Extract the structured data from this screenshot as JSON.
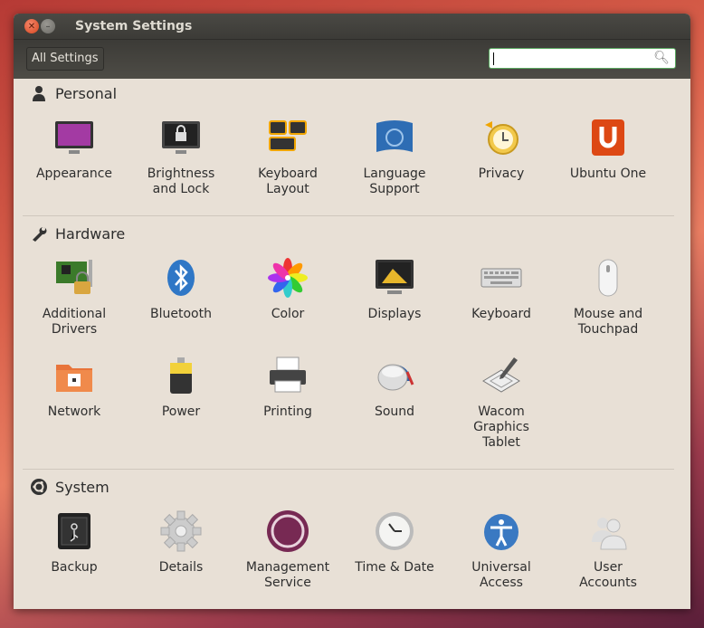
{
  "window": {
    "title": "System Settings"
  },
  "toolbar": {
    "all_settings_label": "All Settings",
    "search": {
      "value": "",
      "placeholder": ""
    }
  },
  "sections": [
    {
      "title": "Personal",
      "icon": "person-icon",
      "items": [
        {
          "label": "Appearance",
          "icon": "appearance-icon"
        },
        {
          "label": "Brightness\nand Lock",
          "icon": "brightness-lock-icon"
        },
        {
          "label": "Keyboard\nLayout",
          "icon": "keyboard-layout-icon"
        },
        {
          "label": "Language\nSupport",
          "icon": "language-support-icon"
        },
        {
          "label": "Privacy",
          "icon": "privacy-icon"
        },
        {
          "label": "Ubuntu One",
          "icon": "ubuntu-one-icon"
        }
      ]
    },
    {
      "title": "Hardware",
      "icon": "wrench-icon",
      "items": [
        {
          "label": "Additional\nDrivers",
          "icon": "additional-drivers-icon"
        },
        {
          "label": "Bluetooth",
          "icon": "bluetooth-icon"
        },
        {
          "label": "Color",
          "icon": "color-icon"
        },
        {
          "label": "Displays",
          "icon": "displays-icon"
        },
        {
          "label": "Keyboard",
          "icon": "keyboard-icon"
        },
        {
          "label": "Mouse and\nTouchpad",
          "icon": "mouse-icon"
        },
        {
          "label": "Network",
          "icon": "network-icon"
        },
        {
          "label": "Power",
          "icon": "power-icon"
        },
        {
          "label": "Printing",
          "icon": "printer-icon"
        },
        {
          "label": "Sound",
          "icon": "sound-icon"
        },
        {
          "label": "Wacom\nGraphics\nTablet",
          "icon": "wacom-tablet-icon"
        }
      ]
    },
    {
      "title": "System",
      "icon": "ubuntu-logo-icon",
      "items": [
        {
          "label": "Backup",
          "icon": "backup-safe-icon"
        },
        {
          "label": "Details",
          "icon": "gear-icon"
        },
        {
          "label": "Management\nService",
          "icon": "management-service-icon"
        },
        {
          "label": "Time & Date",
          "icon": "clock-icon"
        },
        {
          "label": "Universal\nAccess",
          "icon": "universal-access-icon"
        },
        {
          "label": "User\nAccounts",
          "icon": "user-accounts-icon"
        }
      ]
    }
  ],
  "colors": {
    "accent": "#dd4814",
    "background": "#e8e0d6",
    "titlebar": "#3c3b37"
  }
}
